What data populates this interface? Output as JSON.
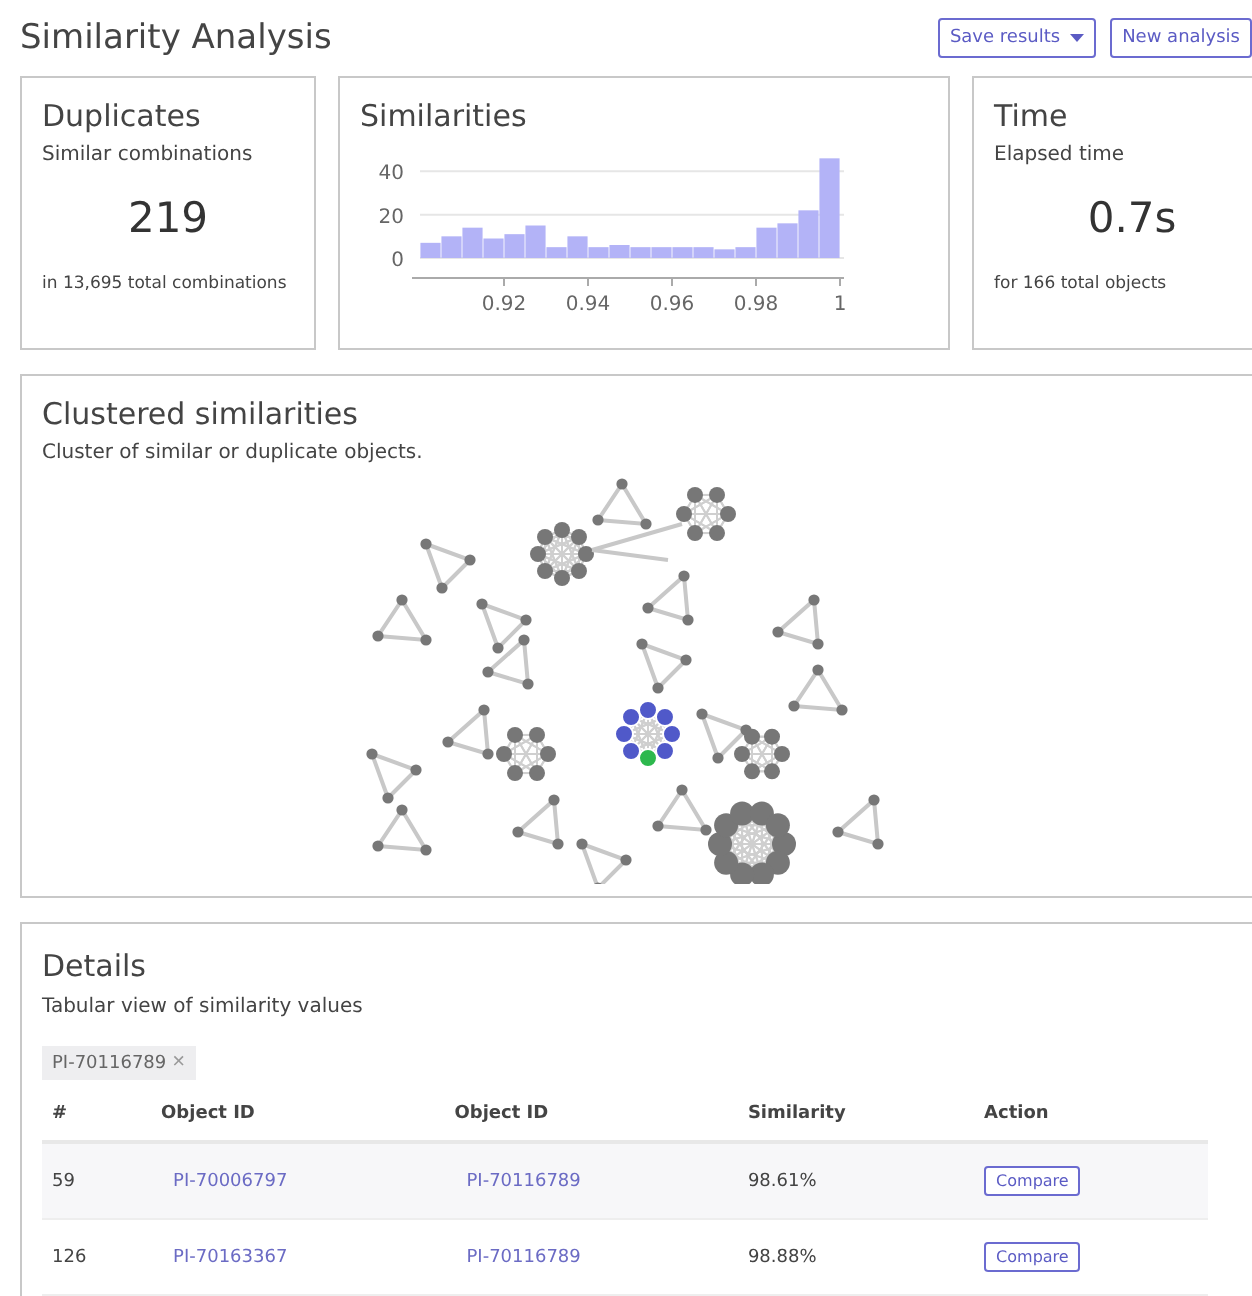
{
  "page_title": "Similarity Analysis",
  "buttons": [
    {
      "label": "Save results",
      "kind": "dropdown"
    },
    {
      "label": "New analysis",
      "kind": "plain"
    }
  ],
  "duplicates": {
    "title": "Duplicates",
    "subtitle": "Similar combinations",
    "value": "219",
    "footer": "in 13,695 total combinations"
  },
  "similarities": {
    "title": "Similarities",
    "chart_data": {
      "type": "bar",
      "x": [
        0.9025,
        0.9075,
        0.9125,
        0.9175,
        0.9225,
        0.9275,
        0.9325,
        0.9375,
        0.9425,
        0.9475,
        0.9525,
        0.9575,
        0.9625,
        0.9675,
        0.9725,
        0.9775,
        0.9825,
        0.9875,
        0.9925,
        0.9975
      ],
      "series": [
        {
          "color": "#b3b3f7",
          "values": [
            7,
            10,
            14,
            9,
            11,
            15,
            5,
            10,
            5,
            6,
            5,
            5,
            5,
            5,
            4,
            5,
            14,
            16,
            22,
            46
          ]
        }
      ],
      "xlim": [
        0.9,
        1.0
      ],
      "ylim": [
        0,
        48
      ],
      "xticks": [
        0.92,
        0.94,
        0.96,
        0.98,
        1
      ],
      "yticks": [
        0,
        20,
        40
      ]
    }
  },
  "time": {
    "title": "Time",
    "subtitle": "Elapsed time",
    "value": "0.7s",
    "footer": "for 166 total objects"
  },
  "clusters": {
    "title": "Clustered similarities",
    "subtitle": "Cluster of similar or duplicate objects."
  },
  "details": {
    "title": "Details",
    "subtitle": "Tabular view of similarity values",
    "filter_tag": "PI-70116789",
    "filter_remove": "×",
    "columns": [
      "#",
      "Object ID",
      "Object ID",
      "Similarity",
      "Action"
    ],
    "rows": [
      {
        "index": "59",
        "object_a": "PI-70006797",
        "object_b": "PI-70116789",
        "similarity": "98.61%",
        "action": "Compare"
      },
      {
        "index": "126",
        "object_a": "PI-70163367",
        "object_b": "PI-70116789",
        "similarity": "98.88%",
        "action": "Compare"
      }
    ]
  }
}
